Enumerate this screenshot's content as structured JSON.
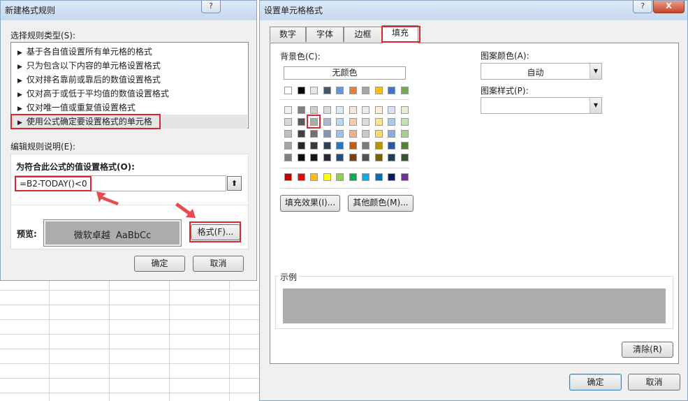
{
  "left_dialog": {
    "title": "新建格式规则",
    "help": "?",
    "rule_type_label": "选择规则类型(S):",
    "rule_types": [
      "基于各自值设置所有单元格的格式",
      "只为包含以下内容的单元格设置格式",
      "仅对排名靠前或靠后的数值设置格式",
      "仅对高于或低于平均值的数值设置格式",
      "仅对唯一值或重复值设置格式",
      "使用公式确定要设置格式的单元格"
    ],
    "edit_desc_label": "编辑规则说明(E):",
    "formula_label": "为符合此公式的值设置格式(O):",
    "formula_value": "=B2-TODAY()<0",
    "preview_label": "预览:",
    "preview_text": "微软卓越  AaBbCc",
    "format_button": "格式(F)...",
    "ok": "确定",
    "cancel": "取消"
  },
  "right_dialog": {
    "title": "设置单元格格式",
    "help": "?",
    "close": "X",
    "tabs": [
      "数字",
      "字体",
      "边框",
      "填充"
    ],
    "active_tab": "填充",
    "bg_color_label": "背景色(C):",
    "no_color": "无颜色",
    "fill_effects": "填充效果(I)...",
    "more_colors": "其他颜色(M)...",
    "pattern_color_label": "图案颜色(A):",
    "pattern_color_value": "自动",
    "pattern_style_label": "图案样式(P):",
    "sample_label": "示例",
    "sample_color": "#aeabab",
    "clear": "清除(R)",
    "ok": "确定",
    "cancel": "取消"
  },
  "palette": {
    "top_row": [
      "#ffffff",
      "#000000",
      "#e7e6e6",
      "#44546a",
      "#5b9bd5",
      "#ed7d31",
      "#a5a5a5",
      "#ffc000",
      "#4472c4",
      "#70ad47"
    ],
    "shades": [
      [
        "#f2f2f2",
        "#7f7f7f",
        "#d0cece",
        "#d6dce4",
        "#deebf6",
        "#fbe5d5",
        "#ededed",
        "#fff2cc",
        "#d9e2f3",
        "#e2efd9"
      ],
      [
        "#d8d8d8",
        "#595959",
        "#aeabab",
        "#adb9ca",
        "#bdd7ee",
        "#f7cbac",
        "#dbdbdb",
        "#fee599",
        "#b4c6e7",
        "#c5e0b3"
      ],
      [
        "#bfbfbf",
        "#3f3f3f",
        "#757070",
        "#8496b0",
        "#9cc3e5",
        "#f4b183",
        "#c9c9c9",
        "#ffd965",
        "#8eaadb",
        "#a8d08d"
      ],
      [
        "#a5a5a5",
        "#262626",
        "#3a3838",
        "#323f4f",
        "#2e75b5",
        "#c55a11",
        "#7b7b7b",
        "#bf9000",
        "#2f5496",
        "#538135"
      ],
      [
        "#7f7f7f",
        "#0c0c0c",
        "#171616",
        "#222a35",
        "#1e4e79",
        "#833c0b",
        "#525252",
        "#7f6000",
        "#1f3864",
        "#375623"
      ]
    ],
    "standard": [
      "#c00000",
      "#ff0000",
      "#ffc000",
      "#ffff00",
      "#92d050",
      "#00b050",
      "#00b0f0",
      "#0070c0",
      "#002060",
      "#7030a0"
    ]
  }
}
